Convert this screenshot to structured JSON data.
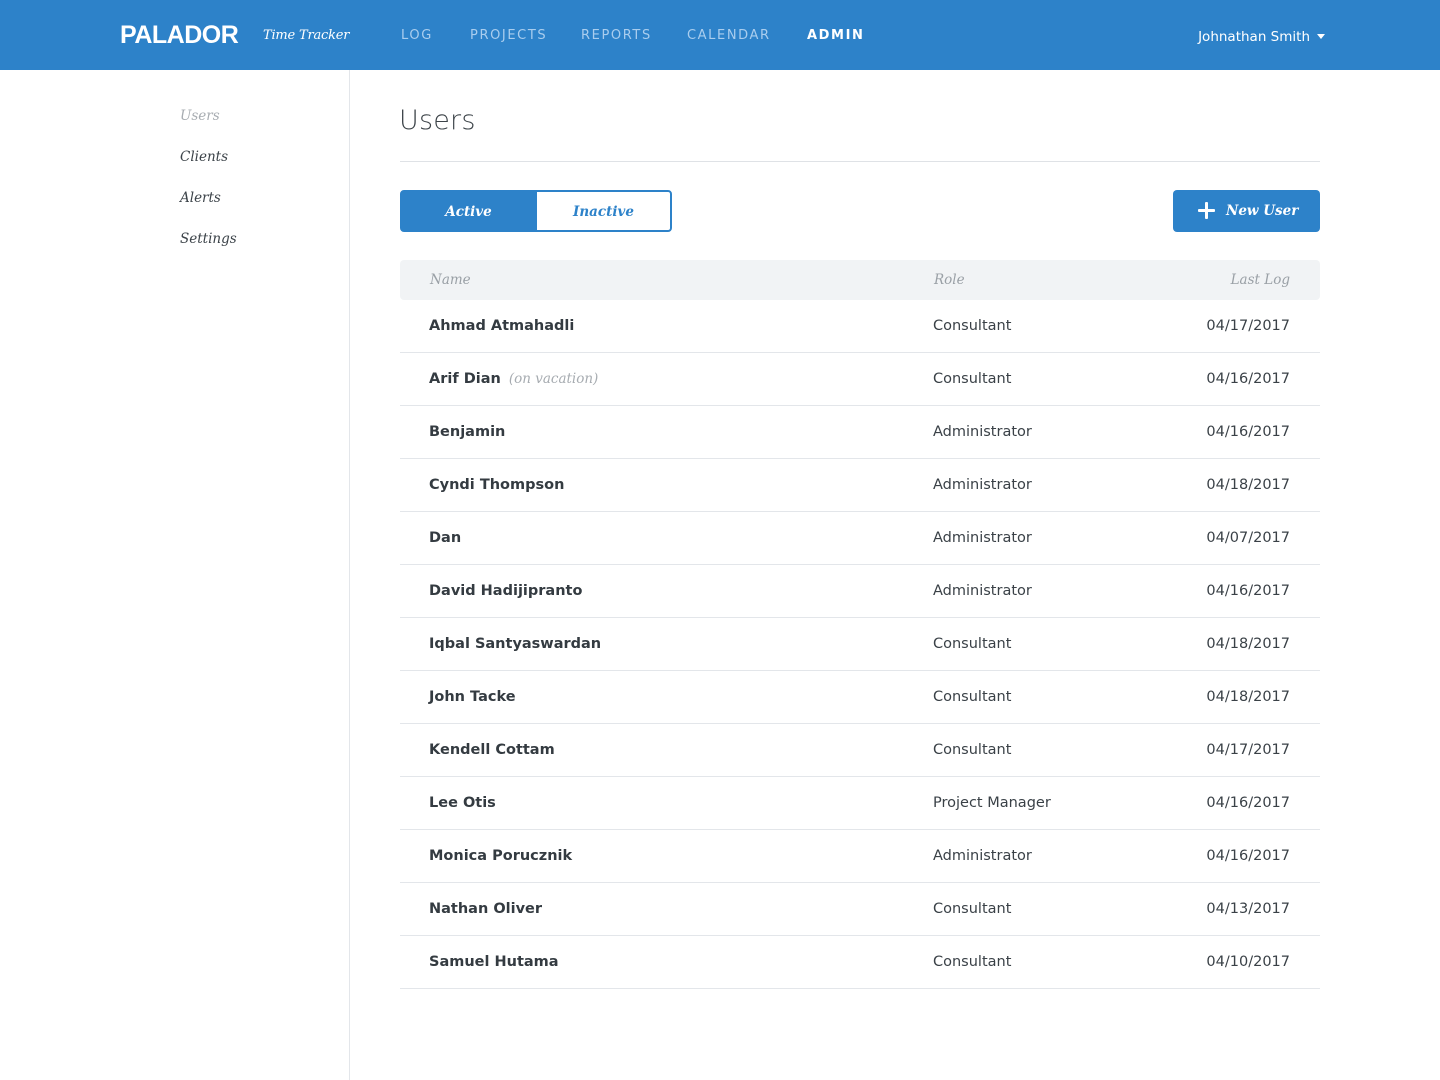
{
  "header": {
    "brand": "PALADOR",
    "app_name": "Time Tracker",
    "nav": [
      {
        "label": "LOG",
        "active": false
      },
      {
        "label": "PROJECTS",
        "active": false
      },
      {
        "label": "REPORTS",
        "active": false
      },
      {
        "label": "CALENDAR",
        "active": false
      },
      {
        "label": "ADMIN",
        "active": true
      }
    ],
    "user_name": "Johnathan Smith"
  },
  "sidebar": {
    "items": [
      {
        "label": "Users",
        "active": true
      },
      {
        "label": "Clients",
        "active": false
      },
      {
        "label": "Alerts",
        "active": false
      },
      {
        "label": "Settings",
        "active": false
      }
    ]
  },
  "main": {
    "title": "Users",
    "toggle": {
      "active_label": "Active",
      "inactive_label": "Inactive",
      "selected": "Active"
    },
    "new_user_label": "New User",
    "table": {
      "columns": {
        "name": "Name",
        "role": "Role",
        "last_log": "Last Log"
      },
      "rows": [
        {
          "name": "Ahmad Atmahadli",
          "note": "",
          "role": "Consultant",
          "last_log": "04/17/2017"
        },
        {
          "name": "Arif Dian",
          "note": "(on vacation)",
          "role": "Consultant",
          "last_log": "04/16/2017"
        },
        {
          "name": "Benjamin",
          "note": "",
          "role": "Administrator",
          "last_log": "04/16/2017"
        },
        {
          "name": "Cyndi Thompson",
          "note": "",
          "role": "Administrator",
          "last_log": "04/18/2017"
        },
        {
          "name": "Dan",
          "note": "",
          "role": "Administrator",
          "last_log": "04/07/2017"
        },
        {
          "name": "David Hadijipranto",
          "note": "",
          "role": "Administrator",
          "last_log": "04/16/2017"
        },
        {
          "name": "Iqbal Santyaswardan",
          "note": "",
          "role": "Consultant",
          "last_log": "04/18/2017"
        },
        {
          "name": "John Tacke",
          "note": "",
          "role": "Consultant",
          "last_log": "04/18/2017"
        },
        {
          "name": "Kendell Cottam",
          "note": "",
          "role": "Consultant",
          "last_log": "04/17/2017"
        },
        {
          "name": "Lee Otis",
          "note": "",
          "role": "Project Manager",
          "last_log": "04/16/2017"
        },
        {
          "name": "Monica Porucznik",
          "note": "",
          "role": "Administrator",
          "last_log": "04/16/2017"
        },
        {
          "name": "Nathan Oliver",
          "note": "",
          "role": "Consultant",
          "last_log": "04/13/2017"
        },
        {
          "name": "Samuel Hutama",
          "note": "",
          "role": "Consultant",
          "last_log": "04/10/2017"
        }
      ]
    }
  },
  "colors": {
    "brand_blue": "#2d82c9",
    "nav_inactive": "#a9cdee",
    "table_header_bg": "#f1f3f5",
    "divider": "#e3e6ea",
    "muted_text": "#a7acb1"
  }
}
